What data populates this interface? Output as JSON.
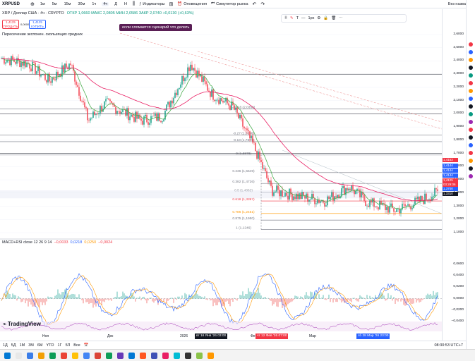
{
  "topbar": {
    "symbol": "XRPUSD",
    "intervals": [
      "1м",
      "5м",
      "15м",
      "30м",
      "1ч",
      "4ч",
      "Д",
      "Н"
    ],
    "selected_interval": "4ч",
    "indicators_label": "Индикаторы",
    "alerts_label": "Оповещения",
    "replay_label": "Симулятор рынка",
    "layout_label": "Без названия"
  },
  "legend": {
    "title": "XRP / Доллар США · 4ч · CRYPTO",
    "ohlc": "ОТКР 1,0660  МАКС 2,0805  МИН 2,0586  ЗАКР 2,0740  +0,0130 (+0,63%)",
    "ema_label": "Пересечение экспонен. скользящих средних",
    "macd_label": "MACD+RSI close 12 26 9 14",
    "macd_values": [
      "−0,0033",
      "0,0218",
      "0,0250",
      "−0,0024"
    ]
  },
  "trade": {
    "sell_price": "1,4125",
    "sell_label": "ПРОДАТЬ",
    "spread": "0,0000",
    "buy_price": "1,4125",
    "buy_label": "КУПИТЬ"
  },
  "tooltip": "если сломается сценарий что делать",
  "drawbar": {
    "width_label": "1px"
  },
  "price_axis": [
    "2,6000",
    "2,5000",
    "2,4000",
    "2,3000",
    "2,2000",
    "2,1000",
    "2,0000",
    "1,9000",
    "1,8000",
    "1,7000",
    "1,6000",
    "1,5000",
    "1,4000",
    "1,3000",
    "1,2000",
    "1,1000"
  ],
  "price_tags": [
    {
      "value": "1,4153",
      "color": "#f23645"
    },
    {
      "value": "1,4144",
      "color": "#2962ff"
    },
    {
      "value": "1,4144",
      "color": "#2962ff"
    },
    {
      "value": "1,4144",
      "color": "#2962ff"
    },
    {
      "value": "1,4125",
      "color": "#f23645"
    },
    {
      "value": "03:29:06",
      "color": "#f23645"
    },
    {
      "value": "1,3700",
      "color": "#2962ff"
    },
    {
      "value": "1,3310",
      "color": "#131722"
    }
  ],
  "macd_axis": [
    "0,0600",
    "0,0400",
    "0,0200",
    "0,0000",
    "−0,0200",
    "−0,0400"
  ],
  "fib_levels": [
    {
      "label": "-0.618 (2,0358)"
    },
    {
      "label": "-0.27 (1,8398)"
    },
    {
      "label": "-0.18 (1,7891)"
    },
    {
      "label": "0 (1,6878)"
    },
    {
      "label": "0.236 (1,5549)"
    },
    {
      "label": "0.382 (1,4726)"
    },
    {
      "label": "0.5 (1,4062)"
    },
    {
      "label": "0.618 (1,3397)"
    },
    {
      "label": "0.786 (1,2451)"
    },
    {
      "label": "0.875 (1,1950)"
    },
    {
      "label": "1 (1,1246)"
    }
  ],
  "time_axis": [
    "Ноя",
    "Дек",
    "2026",
    "Фев",
    "Мар"
  ],
  "time_highlights": [
    {
      "label": "вт 16 Янв '26  03:00",
      "color": "#131722"
    },
    {
      "label": "чт 12 Фев '26  07:00",
      "color": "#f23645"
    },
    {
      "label": "сб 28 Мар '26  23:00",
      "color": "#2962ff"
    }
  ],
  "bottombar": {
    "ranges": [
      "1Д",
      "5Д",
      "1М",
      "3М",
      "6М",
      "YTD",
      "1Г",
      "5Л",
      "Все"
    ],
    "clock": "08:30:53 UTC+7"
  },
  "logo_text": "TradingView",
  "colors": {
    "up": "#089981",
    "down": "#f23645",
    "ema_fast": "#4caf50",
    "ema_slow": "#e91e63",
    "accent": "#2962ff"
  }
}
